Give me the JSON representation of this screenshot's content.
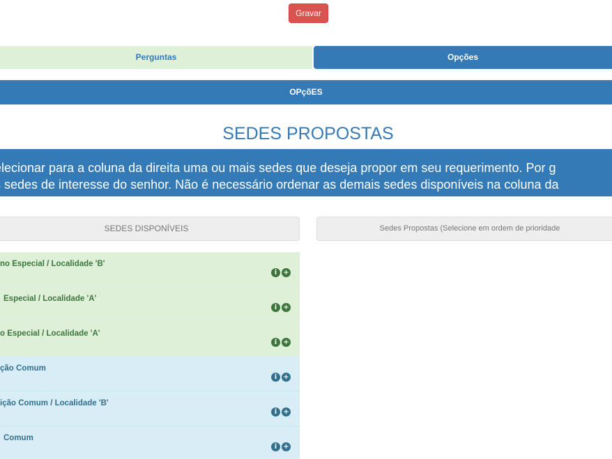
{
  "toolbar": {
    "save_label": "Gravar"
  },
  "tabs": [
    {
      "label": "Perguntas",
      "active": false
    },
    {
      "label": "Opções",
      "active": true
    }
  ],
  "section": {
    "title": "OPçõES"
  },
  "main": {
    "title": "SEDES PROPOSTAS",
    "instructions": [
      "elecionar para a coluna da direita uma ou mais sedes que deseja propor em seu requerimento. Por g",
      "s sedes de interesse do senhor. Não é necessário ordenar as demais sedes disponíveis na coluna da"
    ]
  },
  "columns": {
    "available_header": "SEDES DISPONÍVEIS",
    "proposed_header": "Sedes Propostas (Selecione em ordem de prioridade"
  },
  "sedes": [
    {
      "label": "no Especial / Localidade 'B'",
      "color": "#dff0d8"
    },
    {
      "label": "Especial / Localidade 'A'",
      "color": "#dff0d8"
    },
    {
      "label": "o Especial / Localidade 'A'",
      "color": "#dff0d8"
    },
    {
      "label": "ção Comum",
      "color": "#d9edf7"
    },
    {
      "label": "ição Comum / Localidade 'B'",
      "color": "#d9edf7"
    },
    {
      "label": "Comum",
      "color": "#d9edf7"
    }
  ],
  "icons": {
    "info": "info-circle-icon",
    "add": "plus-circle-icon"
  },
  "colors": {
    "primary": "#337ab7",
    "danger": "#d9534f",
    "success_bg": "#dff0d8",
    "info_bg": "#d9edf7"
  }
}
